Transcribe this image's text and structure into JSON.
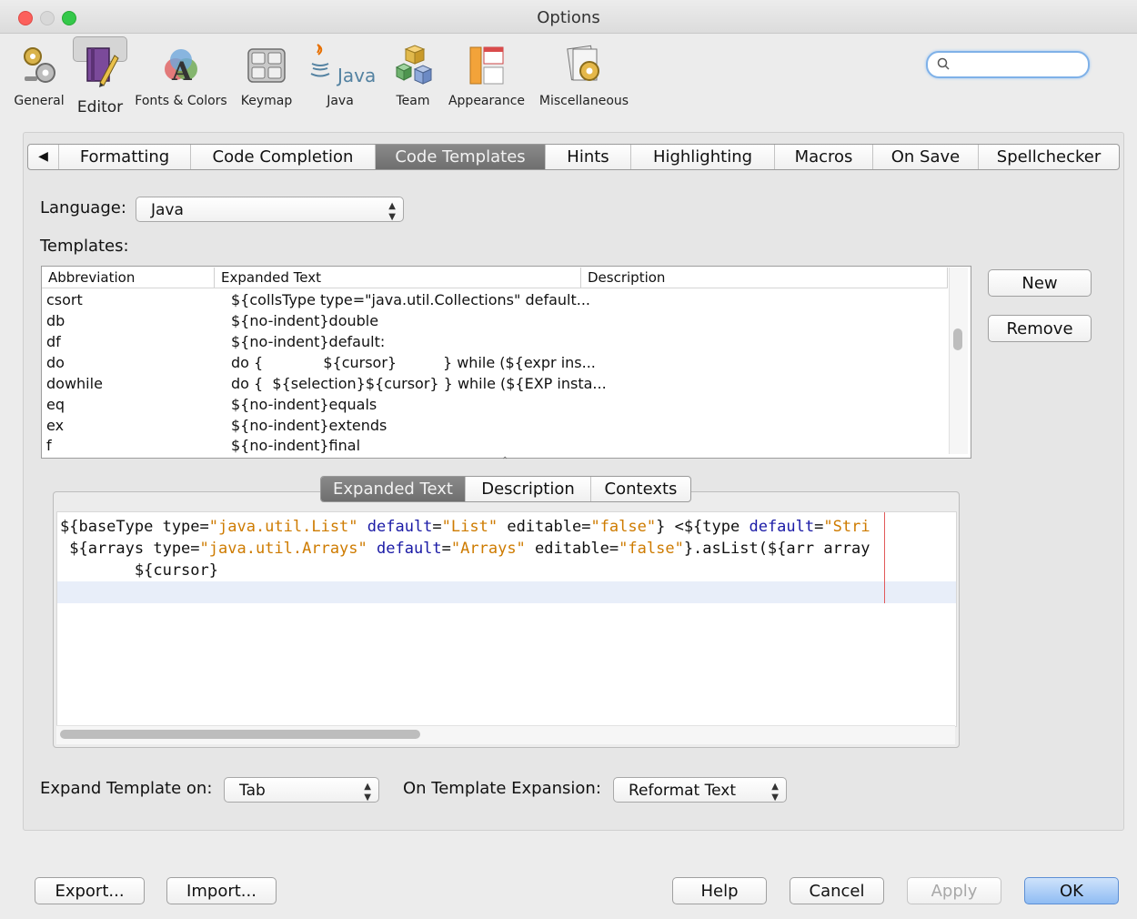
{
  "window": {
    "title": "Options"
  },
  "toolbar": {
    "items": [
      {
        "label": "General",
        "icon": "gears-icon"
      },
      {
        "label": "Editor",
        "icon": "editor-icon",
        "selected": true
      },
      {
        "label": "Fonts & Colors",
        "icon": "fonts-colors-icon"
      },
      {
        "label": "Keymap",
        "icon": "keymap-icon"
      },
      {
        "label": "Java",
        "icon": "java-icon"
      },
      {
        "label": "Team",
        "icon": "team-icon"
      },
      {
        "label": "Appearance",
        "icon": "appearance-icon"
      },
      {
        "label": "Miscellaneous",
        "icon": "miscellaneous-icon"
      }
    ],
    "java_logo_text": "Java",
    "search": {
      "placeholder": "",
      "value": ""
    }
  },
  "tabs": {
    "back_arrow": "◀",
    "items": [
      "Formatting",
      "Code Completion",
      "Code Templates",
      "Hints",
      "Highlighting",
      "Macros",
      "On Save",
      "Spellchecker"
    ],
    "active": "Code Templates"
  },
  "language": {
    "label": "Language:",
    "value": "Java"
  },
  "templates": {
    "label": "Templates:",
    "columns": [
      "Abbreviation",
      "Expanded Text",
      "Description"
    ],
    "rows": [
      {
        "abbr": "csort",
        "text": "${collsType type=\"java.util.Collections\" default...",
        "desc": ""
      },
      {
        "abbr": "db",
        "text": "${no-indent}double",
        "desc": ""
      },
      {
        "abbr": "df",
        "text": "${no-indent}default:",
        "desc": ""
      },
      {
        "abbr": "do",
        "text": "do {             ${cursor}          } while (${expr ins...",
        "desc": ""
      },
      {
        "abbr": "dowhile",
        "text": "do {  ${selection}${cursor} } while (${EXP insta...",
        "desc": ""
      },
      {
        "abbr": "eq",
        "text": "${no-indent}equals",
        "desc": ""
      },
      {
        "abbr": "ex",
        "text": "${no-indent}extends",
        "desc": ""
      },
      {
        "abbr": "f",
        "text": "${no-indent}final",
        "desc": ""
      }
    ],
    "new_button": "New",
    "remove_button": "Remove"
  },
  "inner_tabs": {
    "items": [
      "Expanded Text",
      "Description",
      "Contexts"
    ],
    "active": "Expanded Text"
  },
  "editor": {
    "line1": [
      {
        "t": "${baseType type=",
        "c": "n"
      },
      {
        "t": "\"java.util.List\"",
        "c": "s"
      },
      {
        "t": " default",
        "c": "k"
      },
      {
        "t": "=",
        "c": "n"
      },
      {
        "t": "\"List\"",
        "c": "s"
      },
      {
        "t": " editable=",
        "c": "n"
      },
      {
        "t": "\"false\"",
        "c": "s"
      },
      {
        "t": "} <${type ",
        "c": "n"
      },
      {
        "t": "default",
        "c": "k"
      },
      {
        "t": "=",
        "c": "n"
      },
      {
        "t": "\"Stri",
        "c": "s"
      }
    ],
    "line2": [
      {
        "t": " ${arrays type=",
        "c": "n"
      },
      {
        "t": "\"java.util.Arrays\"",
        "c": "s"
      },
      {
        "t": " default",
        "c": "k"
      },
      {
        "t": "=",
        "c": "n"
      },
      {
        "t": "\"Arrays\"",
        "c": "s"
      },
      {
        "t": " editable=",
        "c": "n"
      },
      {
        "t": "\"false\"",
        "c": "s"
      },
      {
        "t": "}.asList(${arr array",
        "c": "n"
      }
    ],
    "line3": "        ${cursor}",
    "colors": {
      "keyword": "#1a1aa6",
      "string": "#ce7b00",
      "margin": "#e25a5a",
      "current_line": "#e8eef9"
    }
  },
  "expand": {
    "label": "Expand Template on:",
    "value": "Tab"
  },
  "expansion": {
    "label": "On Template Expansion:",
    "value": "Reformat Text"
  },
  "buttons": {
    "export": "Export...",
    "import": "Import...",
    "help": "Help",
    "cancel": "Cancel",
    "apply": "Apply",
    "ok": "OK"
  }
}
